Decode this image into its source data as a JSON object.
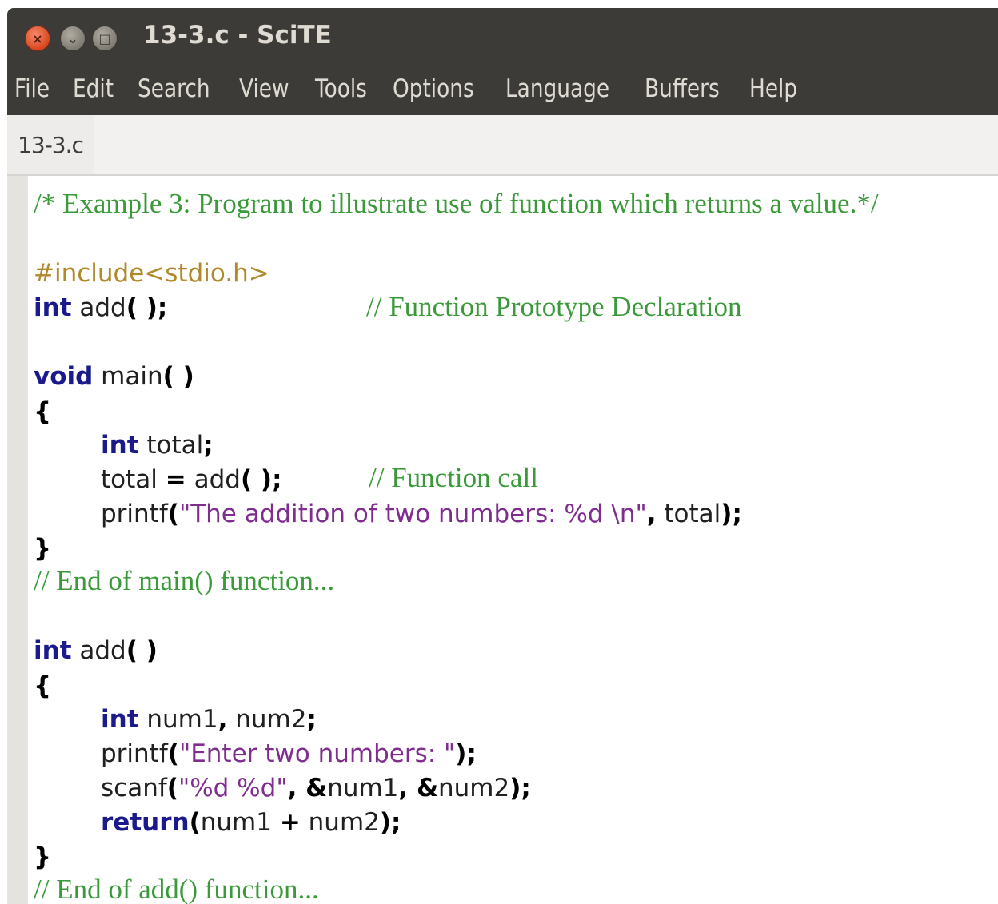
{
  "window": {
    "title": "13-3.c - SciTE",
    "buttons": {
      "close": "×",
      "minimize": "⌄",
      "maximize": "□"
    }
  },
  "menu": [
    "File",
    "Edit",
    "Search",
    "View",
    "Tools",
    "Options",
    "Language",
    "Buffers",
    "Help"
  ],
  "tab": {
    "label": "13-3.c"
  },
  "code": {
    "l1": "/* Example 3: Program to illustrate use of function which returns a value.*/",
    "l3": "#include<stdio.h>",
    "l4_kw": "int",
    "l4_id": " add",
    "l4_op": "( );",
    "l4_cmt": "// Function Prototype Declaration",
    "l6_kw": "void",
    "l6_id": " main",
    "l6_op": "( )",
    "l7": "{",
    "l8_kw": "int",
    "l8_id": " total",
    "l8_op": ";",
    "l9_id1": "total ",
    "l9_op1": "=",
    "l9_id2": " add",
    "l9_op2": "( );",
    "l9_cmt": "// Function call",
    "l10_id": "printf",
    "l10_op1": "(",
    "l10_str": "\"The addition of two numbers: %d \\n\"",
    "l10_op2": ",",
    "l10_id2": " total",
    "l10_op3": ");",
    "l11": "}",
    "l12": "// End of main() function...",
    "l14_kw": "int",
    "l14_id": " add",
    "l14_op": "( )",
    "l15": "{",
    "l16_kw": "int",
    "l16_id1": " num1",
    "l16_op1": ",",
    "l16_id2": " num2",
    "l16_op2": ";",
    "l17_id": "printf",
    "l17_op1": "(",
    "l17_str": "\"Enter two numbers: \"",
    "l17_op2": ");",
    "l18_id": "scanf",
    "l18_op1": "(",
    "l18_str": "\"%d %d\"",
    "l18_op2": ", &",
    "l18_id2": "num1",
    "l18_op3": ", &",
    "l18_id3": "num2",
    "l18_op4": ");",
    "l19_kw": "return",
    "l19_op1": "(",
    "l19_id1": "num1 ",
    "l19_op2": "+",
    "l19_id2": " num2",
    "l19_op3": ");",
    "l20": "}",
    "l21": "// End of add() function..."
  }
}
